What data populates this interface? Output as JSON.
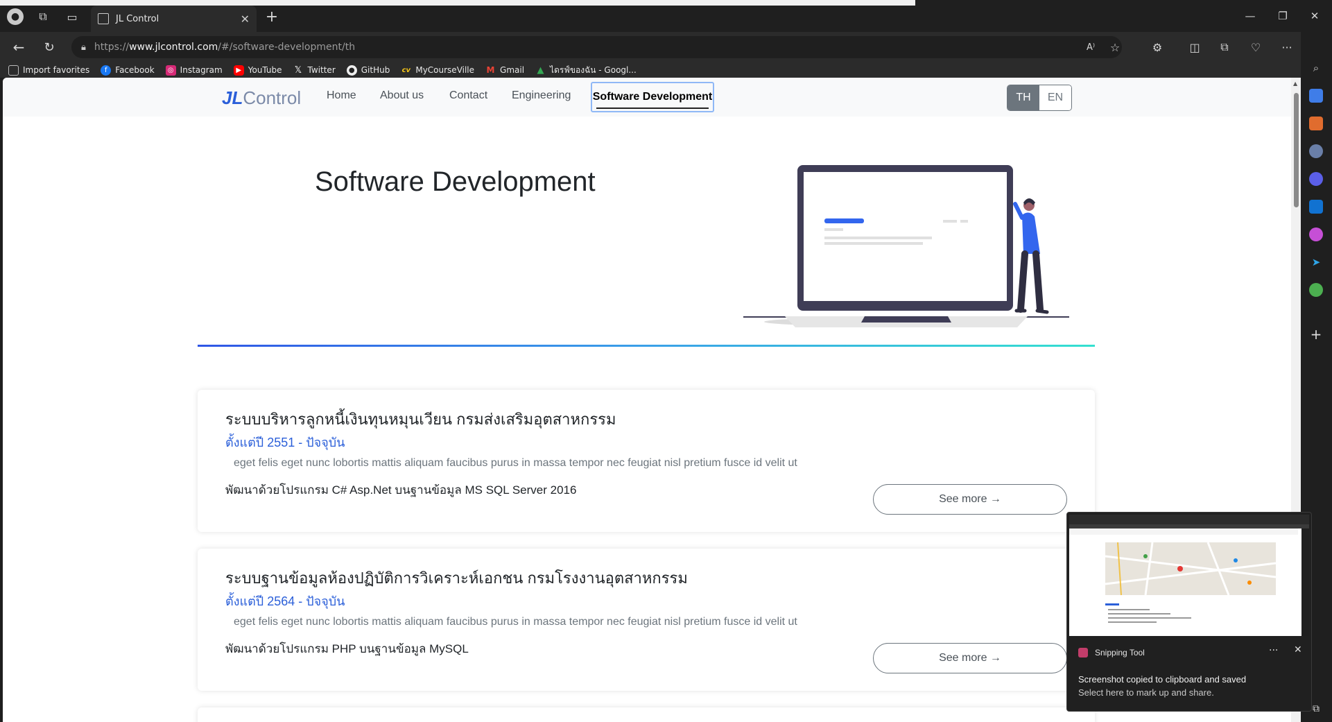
{
  "browser": {
    "tab_title": "JL Control",
    "url_prefix": "https://",
    "url_domain": "www.jlcontrol.com",
    "url_path": "/#/software-development/th",
    "bookmarks": [
      {
        "label": "Import favorites",
        "icon": "import-icon",
        "color": "#555555"
      },
      {
        "label": "Facebook",
        "icon": "facebook-icon",
        "color": "#1877f2"
      },
      {
        "label": "Instagram",
        "icon": "instagram-icon",
        "color": "#d62976"
      },
      {
        "label": "YouTube",
        "icon": "youtube-icon",
        "color": "#ff0000"
      },
      {
        "label": "Twitter",
        "icon": "x-icon",
        "color": "#000000"
      },
      {
        "label": "GitHub",
        "icon": "github-icon",
        "color": "#333333"
      },
      {
        "label": "MyCourseVille",
        "icon": "mycourseville-icon",
        "color": "#2f5fd6"
      },
      {
        "label": "Gmail",
        "icon": "gmail-icon",
        "color": "#ea4335"
      },
      {
        "label": "ไดรฟ์ของฉัน - Googl...",
        "icon": "google-drive-icon",
        "color": "#34a853"
      }
    ]
  },
  "site": {
    "logo_jl": "JL",
    "logo_control": "Control",
    "nav": {
      "home": "Home",
      "about": "About us",
      "contact": "Contact",
      "engineering": "Engineering",
      "software": "Software Development"
    },
    "lang_th": "TH",
    "lang_en": "EN",
    "hero_title": "Software Development",
    "accent_color": "#2b5fd9",
    "projects": [
      {
        "title": "ระบบบริหารลูกหนี้เงินทุนหมุนเวียน กรมส่งเสริมอุตสาหกรรม",
        "since": "ตั้งแต่ปี 2551 - ปัจจุบัน",
        "description": "eget felis eget nunc lobortis mattis aliquam faucibus purus in massa tempor nec feugiat nisl pretium fusce id velit ut",
        "tech": "พัฒนาด้วยโปรแกรม C# Asp.Net บนฐานข้อมูล MS SQL Server 2016",
        "button": "See more →"
      },
      {
        "title": "ระบบฐานข้อมูลห้องปฏิบัติการวิเคราะห์เอกชน กรมโรงงานอุตสาหกรรม",
        "since": "ตั้งแต่ปี 2564 - ปัจจุบัน",
        "description": "eget felis eget nunc lobortis mattis aliquam faucibus purus in massa tempor nec feugiat nisl pretium fusce id velit ut",
        "tech": "พัฒนาด้วยโปรแกรม PHP บนฐานข้อมูล MySQL",
        "button": "See more →"
      }
    ]
  },
  "toast": {
    "app_name": "Snipping Tool",
    "line1": "Screenshot copied to clipboard and saved",
    "line2": "Select here to mark up and share.",
    "more": "···",
    "close": "✕"
  }
}
